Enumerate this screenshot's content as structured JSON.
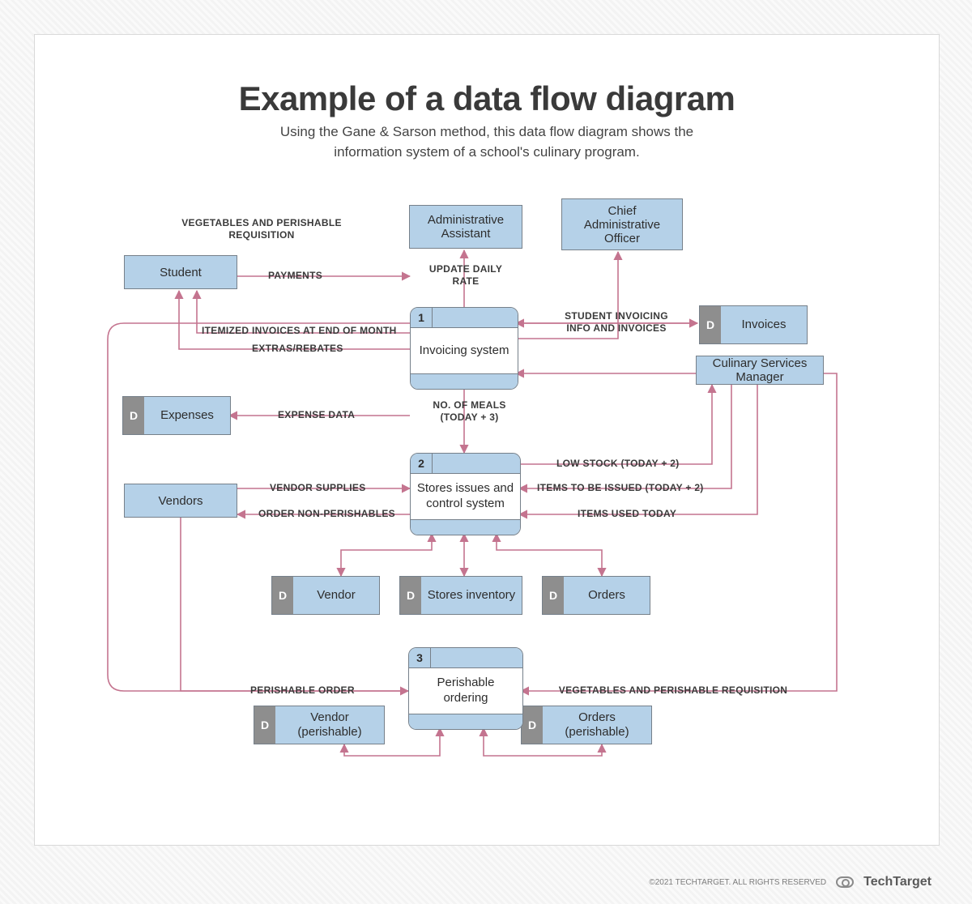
{
  "title": "Example of a data flow diagram",
  "subtitle_l1": "Using the Gane & Sarson method, this data flow diagram shows the",
  "subtitle_l2": "information system of a school's culinary program.",
  "entities": {
    "admin_assistant": "Administrative Assistant",
    "cao": "Chief Administrative Officer",
    "student": "Student",
    "csm": "Culinary Services Manager",
    "vendors": "Vendors"
  },
  "stores": {
    "tag": "D",
    "invoices": "Invoices",
    "expenses": "Expenses",
    "vendor": "Vendor",
    "stores_inventory": "Stores inventory",
    "orders": "Orders",
    "vendor_perishable": "Vendor (perishable)",
    "orders_perishable": "Orders (perishable)"
  },
  "processes": {
    "p1": {
      "num": "1",
      "name": "Invoicing system"
    },
    "p2": {
      "num": "2",
      "name": "Stores issues and control system"
    },
    "p3": {
      "num": "3",
      "name": "Perishable ordering"
    }
  },
  "flows": {
    "veg_req_top": "VEGETABLES AND PERISHABLE REQUISITION",
    "payments": "PAYMENTS",
    "update_daily_rate": "UPDATE DAILY RATE",
    "student_inv": "STUDENT INVOICING INFO AND INVOICES",
    "itemized": "ITEMIZED INVOICES AT END OF MONTH",
    "extras": "EXTRAS/REBATES",
    "expense_data": "EXPENSE DATA",
    "no_meals": "NO. OF MEALS (TODAY + 3)",
    "vendor_supplies": "VENDOR SUPPLIES",
    "order_nonperish": "ORDER NON-PERISHABLES",
    "low_stock": "LOW STOCK (TODAY + 2)",
    "items_to_issue": "ITEMS TO BE ISSUED (TODAY + 2)",
    "items_used": "ITEMS USED TODAY",
    "perishable_order": "PERISHABLE ORDER",
    "veg_req_bottom": "VEGETABLES AND PERISHABLE REQUISITION"
  },
  "footer": {
    "copyright": "©2021 TECHTARGET. ALL RIGHTS RESERVED",
    "brand": "TechTarget"
  }
}
